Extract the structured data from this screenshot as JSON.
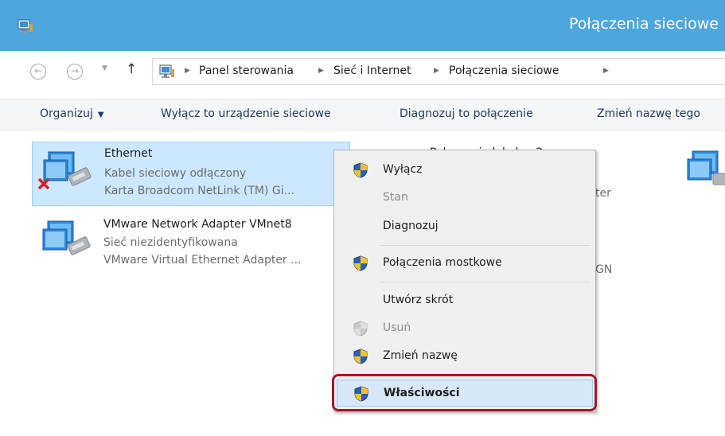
{
  "window": {
    "title": "Połączenia sieciowe"
  },
  "address": {
    "breadcrumbs": [
      "Panel sterowania",
      "Sieć i Internet",
      "Połączenia sieciowe"
    ]
  },
  "commands": {
    "organize": "Organizuj",
    "disable_device": "Wyłącz to urządzenie sieciowe",
    "diagnose": "Diagnozuj to połączenie",
    "rename": "Zmień nazwę tego"
  },
  "connections": [
    {
      "name": "Ethernet",
      "status": "Kabel sieciowy odłączony",
      "adapter": "Karta Broadcom NetLink (TM) Gi..."
    },
    {
      "name": "VMware Network Adapter VMnet8",
      "status": "Sieć niezidentyfikowana",
      "adapter": "VMware Virtual Ethernet Adapter ..."
    }
  ],
  "partial_items": {
    "second_col_name": "Połączenie lokalne 2",
    "second_col_adapter_tail": "ter",
    "second_col_adapter2_tail": "GN"
  },
  "context_menu": {
    "items": [
      {
        "label": "Wyłącz",
        "shield": true,
        "disabled": false
      },
      {
        "label": "Stan",
        "shield": false,
        "disabled": true
      },
      {
        "label": "Diagnozuj",
        "shield": false,
        "disabled": false
      },
      {
        "label": "Połączenia mostkowe",
        "shield": true,
        "disabled": false
      },
      {
        "label": "Utwórz skrót",
        "shield": false,
        "disabled": false
      },
      {
        "label": "Usuń",
        "shield": true,
        "disabled": true
      },
      {
        "label": "Zmień nazwę",
        "shield": true,
        "disabled": false
      },
      {
        "label": "Właściwości",
        "shield": true,
        "disabled": false,
        "highlighted": true
      }
    ]
  },
  "colors": {
    "titlebar": "#4ea6dc",
    "selection": "#cce8ff",
    "highlight_ring": "#a4162c"
  }
}
